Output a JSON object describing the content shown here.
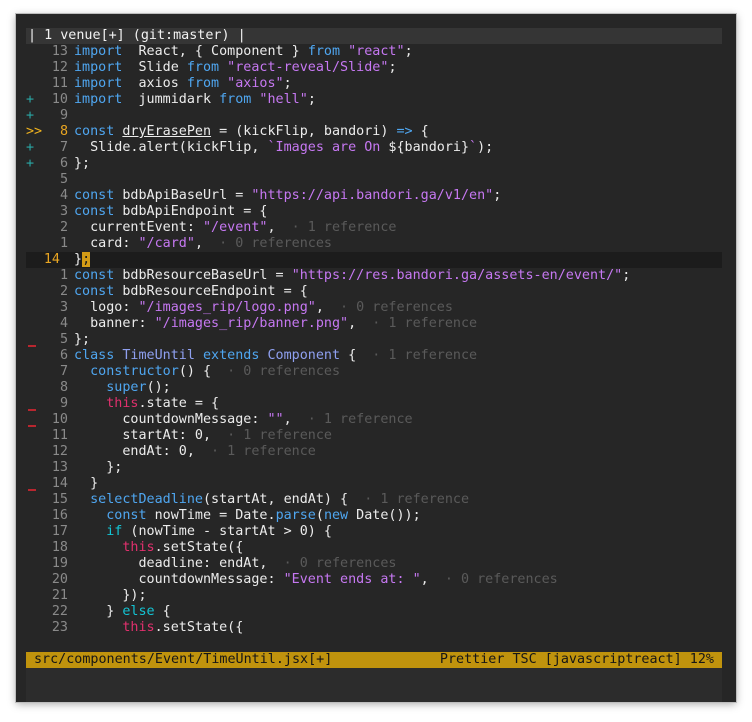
{
  "tabline": {
    "pre": "| 1 ",
    "name": "venue",
    "flag": "[+]",
    "branch": " (git:master)",
    "post": " |"
  },
  "lines": [
    {
      "sign": "",
      "num": "13",
      "segs": [
        [
          "k",
          "import"
        ],
        [
          "",
          "  React, { Component } "
        ],
        [
          "k",
          "from"
        ],
        [
          "",
          ""
        ],
        [
          "s",
          " \"react\""
        ],
        [
          "",
          ";"
        ]
      ]
    },
    {
      "sign": "",
      "num": "12",
      "segs": [
        [
          "k",
          "import"
        ],
        [
          "",
          "  Slide "
        ],
        [
          "k",
          "from"
        ],
        [
          "s",
          " \"react-reveal/Slide\""
        ],
        [
          "",
          ";"
        ]
      ]
    },
    {
      "sign": "",
      "num": "11",
      "segs": [
        [
          "k",
          "import"
        ],
        [
          "",
          "  axios "
        ],
        [
          "k",
          "from"
        ],
        [
          "s",
          " \"axios\""
        ],
        [
          "",
          ";"
        ]
      ]
    },
    {
      "sign": "+",
      "num": "10",
      "segs": [
        [
          "k",
          "import"
        ],
        [
          "",
          "  jummidark "
        ],
        [
          "k",
          "from"
        ],
        [
          "s",
          " \"hell\""
        ],
        [
          "",
          ";"
        ]
      ]
    },
    {
      "sign": "+",
      "num": "9",
      "segs": []
    },
    {
      "sign": ">>",
      "num": "8",
      "numcur": true,
      "segs": [
        [
          "k",
          "const"
        ],
        [
          "",
          " "
        ],
        [
          "ul",
          "dryErasePen"
        ],
        [
          "",
          " = (kickFlip, bandori) "
        ],
        [
          "k",
          "=>"
        ],
        [
          "",
          " {"
        ]
      ]
    },
    {
      "sign": "+",
      "num": "7",
      "segs": [
        [
          "",
          "  Slide.alert(kickFlip, "
        ],
        [
          "s",
          "`Images are On "
        ],
        [
          "",
          "${bandori}"
        ],
        [
          "s",
          "`"
        ],
        [
          "",
          ");"
        ]
      ]
    },
    {
      "sign": "+",
      "num": "6",
      "segs": [
        [
          "",
          "};"
        ]
      ]
    },
    {
      "sign": "",
      "num": "5",
      "segs": []
    },
    {
      "sign": "",
      "num": "4",
      "segs": [
        [
          "k",
          "const"
        ],
        [
          "",
          ""
        ],
        [
          "",
          " bdbApiBaseUrl = "
        ],
        [
          "s",
          "\"https://api.bandori.ga/v1/en\""
        ],
        [
          "",
          ";"
        ]
      ]
    },
    {
      "sign": "",
      "num": "3",
      "segs": [
        [
          "k",
          "const"
        ],
        [
          "",
          " bdbApiEndpoint = {"
        ]
      ]
    },
    {
      "sign": "",
      "num": "2",
      "segs": [
        [
          "",
          "  currentEvent: "
        ],
        [
          "s",
          "\"/event\""
        ],
        [
          "",
          ","
        ],
        [
          "rf",
          "  · 1 reference"
        ]
      ]
    },
    {
      "sign": "",
      "num": "1",
      "segs": [
        [
          "",
          "  card: "
        ],
        [
          "s",
          "\"/card\""
        ],
        [
          "",
          ","
        ],
        [
          "rf",
          "  · 0 references"
        ]
      ]
    },
    {
      "sign": "",
      "num": "14",
      "wide": true,
      "cur": true,
      "numcur": true,
      "segs": [
        [
          "",
          "}"
        ],
        [
          "blk",
          ";"
        ]
      ]
    },
    {
      "sign": "",
      "num": "1",
      "segs": [
        [
          "k",
          "const"
        ],
        [
          "",
          " bdbResourceBaseUrl = "
        ],
        [
          "s",
          "\"https://res.bandori.ga/assets-en/event/\""
        ],
        [
          "",
          ";"
        ]
      ]
    },
    {
      "sign": "",
      "num": "2",
      "segs": [
        [
          "k",
          "const"
        ],
        [
          "",
          " bdbResourceEndpoint = {"
        ]
      ]
    },
    {
      "sign": "",
      "num": "3",
      "segs": [
        [
          "",
          "  logo: "
        ],
        [
          "s",
          "\"/images_rip/logo.png\""
        ],
        [
          "",
          ","
        ],
        [
          "rf",
          "  · 0 references"
        ]
      ]
    },
    {
      "sign": "",
      "num": "4",
      "segs": [
        [
          "",
          "  banner: "
        ],
        [
          "s",
          "\"/images_rip/banner.png\""
        ],
        [
          "",
          ","
        ],
        [
          "rf",
          "  · 1 reference"
        ]
      ]
    },
    {
      "sign": "_",
      "num": "5",
      "segs": [
        [
          "",
          "};"
        ]
      ]
    },
    {
      "sign": "",
      "num": "6",
      "segs": [
        [
          "k",
          "class"
        ],
        [
          "",
          " "
        ],
        [
          "ty",
          "TimeUntil"
        ],
        [
          "",
          " "
        ],
        [
          "k",
          "extends"
        ],
        [
          "",
          " "
        ],
        [
          "ty",
          "Component"
        ],
        [
          "",
          " {"
        ],
        [
          "rf",
          "  · 1 reference"
        ]
      ]
    },
    {
      "sign": "",
      "num": "7",
      "segs": [
        [
          "",
          "  "
        ],
        [
          "k",
          "constructor"
        ],
        [
          "",
          "() {"
        ],
        [
          "rf",
          "  · 0 references"
        ]
      ]
    },
    {
      "sign": "",
      "num": "8",
      "segs": [
        [
          "",
          "    "
        ],
        [
          "k",
          "super"
        ],
        [
          "",
          "();"
        ]
      ]
    },
    {
      "sign": "_",
      "num": "9",
      "segs": [
        [
          "",
          "    "
        ],
        [
          "th",
          "this"
        ],
        [
          "",
          ".state = {"
        ]
      ]
    },
    {
      "sign": "_",
      "num": "10",
      "segs": [
        [
          "",
          "      countdownMessage: "
        ],
        [
          "s",
          "\"\""
        ],
        [
          "",
          ","
        ],
        [
          "rf",
          "  · 1 reference"
        ]
      ]
    },
    {
      "sign": "",
      "num": "11",
      "segs": [
        [
          "",
          "      startAt: 0,"
        ],
        [
          "rf",
          "  · 1 reference"
        ]
      ]
    },
    {
      "sign": "",
      "num": "12",
      "segs": [
        [
          "",
          "      endAt: 0,"
        ],
        [
          "rf",
          "  · 1 reference"
        ]
      ]
    },
    {
      "sign": "",
      "num": "13",
      "segs": [
        [
          "",
          "    };"
        ]
      ]
    },
    {
      "sign": "_",
      "num": "14",
      "segs": [
        [
          "",
          "  }"
        ]
      ]
    },
    {
      "sign": "",
      "num": "15",
      "segs": [
        [
          "",
          "  "
        ],
        [
          "k",
          "selectDeadline"
        ],
        [
          "",
          "(startAt, endAt) {"
        ],
        [
          "rf",
          "  · 1 reference"
        ]
      ]
    },
    {
      "sign": "",
      "num": "16",
      "segs": [
        [
          "",
          "    "
        ],
        [
          "k",
          "const"
        ],
        [
          "",
          " nowTime = Date."
        ],
        [
          "k",
          "parse"
        ],
        [
          "",
          "("
        ],
        [
          "k",
          "new"
        ],
        [
          "",
          " Date());"
        ]
      ]
    },
    {
      "sign": "",
      "num": "17",
      "segs": [
        [
          "",
          "    "
        ],
        [
          "kc",
          "if"
        ],
        [
          "",
          " (nowTime - startAt > 0) {"
        ]
      ]
    },
    {
      "sign": "",
      "num": "18",
      "segs": [
        [
          "",
          "      "
        ],
        [
          "th",
          "this"
        ],
        [
          "",
          ".setState({"
        ]
      ]
    },
    {
      "sign": "",
      "num": "19",
      "segs": [
        [
          "",
          "        deadline: endAt,"
        ],
        [
          "rf",
          "  · 0 references"
        ]
      ]
    },
    {
      "sign": "",
      "num": "20",
      "segs": [
        [
          "",
          "        countdownMessage: "
        ],
        [
          "s",
          "\"Event ends at: \""
        ],
        [
          "",
          ","
        ],
        [
          "rf",
          "  · 0 references"
        ]
      ]
    },
    {
      "sign": "",
      "num": "21",
      "segs": [
        [
          "",
          "      });"
        ]
      ]
    },
    {
      "sign": "",
      "num": "22",
      "segs": [
        [
          "",
          "    } "
        ],
        [
          "kc",
          "else"
        ],
        [
          "",
          " {"
        ]
      ]
    },
    {
      "sign": "",
      "num": "23",
      "segs": [
        [
          "",
          "      "
        ],
        [
          "th",
          "this"
        ],
        [
          "",
          ".setState({"
        ]
      ]
    }
  ],
  "statusline": {
    "left": "src/components/Event/TimeUntil.jsx[+]",
    "right": "Prettier TSC [javascriptreact] 12%"
  }
}
